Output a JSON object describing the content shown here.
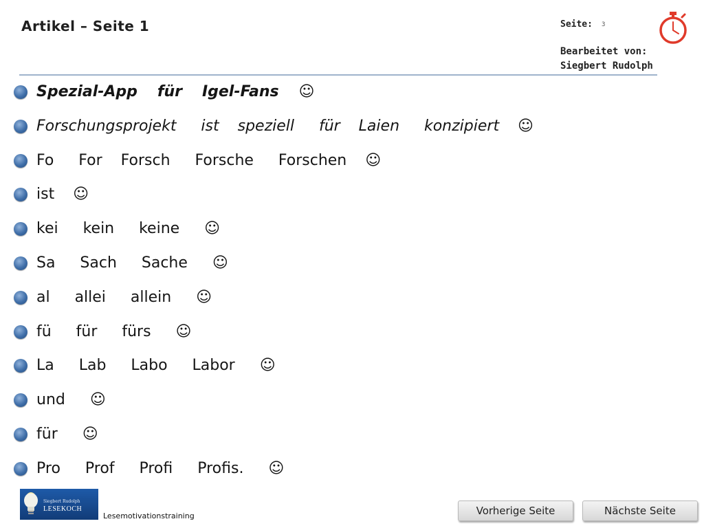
{
  "header": {
    "title": "Artikel – Seite 1",
    "page_label": "Seite:",
    "page_number": "3",
    "editor_label": "Bearbeitet von:",
    "editor_name": "Siegbert Rudolph"
  },
  "icons": {
    "stopwatch": "stopwatch-icon",
    "bullet": "bullet-icon",
    "logo": "lightbulb-logo"
  },
  "colors": {
    "bullet": "#3f6ea8",
    "rule": "#9fb3cc",
    "stopwatch": "#e03a2a",
    "logo_bg": "#1e5aa8"
  },
  "items": [
    {
      "text": "Spezial-App   für   Igel-Fans   ☺"
    },
    {
      "text": "Forschungsprojekt    ist   speziell    für   Laien    konzipiert   ☺"
    },
    {
      "text": "Fo    For   Forsch    Forsche    Forschen   ☺"
    },
    {
      "text": "ist   ☺"
    },
    {
      "text": "kei    kein    keine    ☺"
    },
    {
      "text": "Sa    Sach    Sache    ☺"
    },
    {
      "text": "al    allei    allein    ☺"
    },
    {
      "text": "fü    für    fürs    ☺"
    },
    {
      "text": "La    Lab    Labo    Labor    ☺"
    },
    {
      "text": "und    ☺"
    },
    {
      "text": "für    ☺"
    },
    {
      "text": "Pro    Prof    Profi    Profis.    ☺"
    }
  ],
  "footer": {
    "logo_name": "Siegbert Rudolph",
    "logo_brand": "LESEKOCH",
    "label": "Lesemotivationstraining",
    "prev_button": "Vorherige Seite",
    "next_button": "Nächste Seite"
  }
}
